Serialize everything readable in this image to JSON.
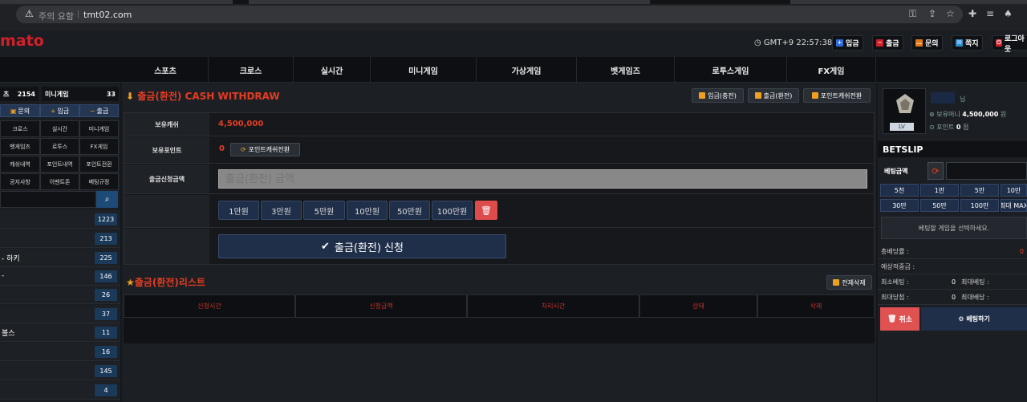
{
  "browser": {
    "warning": "주의 요함",
    "url": "tmt02.com",
    "warning_icon": "warning-triangle-icon",
    "icons": [
      "key-icon",
      "share-icon",
      "star-icon",
      "extension-icon",
      "reading-list-icon",
      "profile-icon"
    ]
  },
  "header": {
    "logo": "mato",
    "clock": "GMT+9 22:57:38",
    "buttons": [
      {
        "label": "입금",
        "icon": "plus-icon",
        "color": "#2d6cdf"
      },
      {
        "label": "출금",
        "icon": "minus-icon",
        "color": "#d0202a"
      },
      {
        "label": "문의",
        "icon": "chat-icon",
        "color": "#e0781a"
      },
      {
        "label": "쪽지",
        "icon": "mail-icon",
        "color": "#2d8fd0"
      },
      {
        "label": "로그아웃",
        "icon": "power-icon",
        "color": "#d0202a"
      }
    ]
  },
  "nav": [
    "스포츠",
    "크로스",
    "실시간",
    "미니게임",
    "가상게임",
    "벳게임즈",
    "로투스게임",
    "FX게임"
  ],
  "sidebar": {
    "tab1_label": "츠",
    "tab1_count": "2154",
    "tab2_label": "미니게임",
    "tab2_count": "33",
    "actions": [
      "문의",
      "입금",
      "출금"
    ],
    "grid": [
      "크로스",
      "실시간",
      "미니게임",
      "벳게임즈",
      "로투스",
      "FX게임",
      "캐쉬내역",
      "포인트내역",
      "포인트전환",
      "공지사항",
      "이벤트존",
      "베팅규정"
    ],
    "items": [
      {
        "label": "",
        "count": "1223"
      },
      {
        "label": "",
        "count": "213"
      },
      {
        "label": "- 하키",
        "count": "225"
      },
      {
        "label": "-",
        "count": "146"
      },
      {
        "label": "",
        "count": "26"
      },
      {
        "label": "",
        "count": "37"
      },
      {
        "label": "볼스",
        "count": "11"
      },
      {
        "label": "",
        "count": "16"
      },
      {
        "label": "",
        "count": "145"
      },
      {
        "label": "",
        "count": "4"
      }
    ]
  },
  "withdraw": {
    "title": "출금(환전) CASH WITHDRAW",
    "top_buttons": [
      "입금(충전)",
      "출금(환전)",
      "포인트캐쉬전환"
    ],
    "cash_label": "보유캐쉬",
    "cash_value": "4,500,000",
    "point_label": "보유포인트",
    "point_value": "0",
    "convert_label": "포인트캐쉬전환",
    "amount_label": "출금신청금액",
    "amount_placeholder": "출금(환전) 금액",
    "quick_amounts": [
      "1만원",
      "3만원",
      "5만원",
      "10만원",
      "50만원",
      "100만원"
    ],
    "submit_label": "출금(환전) 신청"
  },
  "list": {
    "title": "출금(환전)리스트",
    "delete_all": "전체삭제",
    "columns": [
      "신청시간",
      "신청금액",
      "처리시간",
      "상태",
      "삭제"
    ]
  },
  "user": {
    "name_suffix": "님",
    "money_label": "보유머니",
    "money_value": "4,500,000",
    "money_unit": "원",
    "point_label": "포인트",
    "point_value": "0",
    "point_unit": "점",
    "level": "LV"
  },
  "betslip": {
    "title": "BETSLIP",
    "amount_label": "베팅금액",
    "chips": [
      "5천",
      "1만",
      "5만",
      "10만",
      "30만",
      "50만",
      "100만",
      "최대 MAX"
    ],
    "select_msg": "베팅할 게임을 선택하세요.",
    "total_odds_label": "총배당률 :",
    "total_odds_value": "0",
    "expected_label": "예상적중금 :",
    "min_bet_label": "최소베팅 :",
    "min_bet_value": "0",
    "max_bet_label": "최대베팅 :",
    "max_win_label": "최대당첨 :",
    "max_win_value": "0",
    "max_odds_label": "최대배당 :",
    "cancel_label": "취소",
    "place_label": "베팅하기"
  }
}
